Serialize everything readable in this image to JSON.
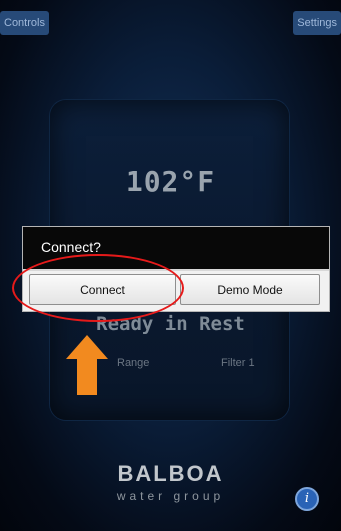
{
  "header": {
    "controls_label": "Controls",
    "settings_label": "Settings"
  },
  "status": {
    "temperature": "102°F",
    "ready_text": "Ready in Rest",
    "range_label": "Range",
    "filter_label": "Filter 1"
  },
  "dialog": {
    "title": "Connect?",
    "connect_label": "Connect",
    "demo_label": "Demo Mode"
  },
  "logo": {
    "brand": "BALBOA",
    "tagline": "water group"
  },
  "annotation": {
    "highlight_color": "#e61a1a",
    "arrow_color": "#f28a1f"
  },
  "icons": {
    "info": "info-icon",
    "arrow": "up-arrow-icon"
  }
}
